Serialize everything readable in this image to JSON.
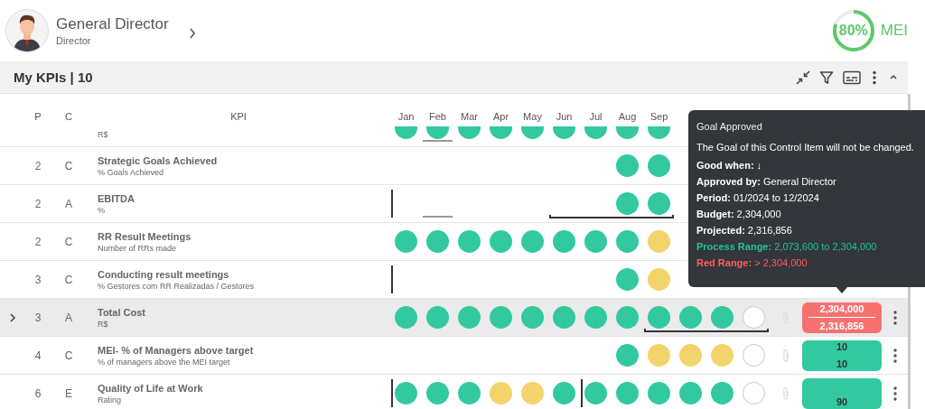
{
  "profile": {
    "name": "General Director",
    "role": "Director"
  },
  "score": {
    "value": "80%",
    "label": "MEI",
    "level": 0.8
  },
  "panel": {
    "title": "My KPIs | 10"
  },
  "columns": {
    "p": "P",
    "c": "C",
    "kpi": "KPI",
    "months": [
      "Jan",
      "Feb",
      "Mar",
      "Apr",
      "May",
      "Jun",
      "Jul",
      "Aug",
      "Sep"
    ]
  },
  "rows": [
    {
      "subtitle": "R$",
      "selected": false,
      "cells": [
        {
          "kind": "dot",
          "color": "#33c9a0"
        },
        {
          "kind": "dot",
          "color": "#33c9a0",
          "underline": true
        },
        {
          "kind": "dot",
          "color": "#33c9a0"
        },
        {
          "kind": "dot",
          "color": "#33c9a0"
        },
        {
          "kind": "dot",
          "color": "#33c9a0"
        },
        {
          "kind": "dot",
          "color": "#33c9a0"
        },
        {
          "kind": "dot",
          "color": "#33c9a0"
        },
        {
          "kind": "dot",
          "color": "#33c9a0"
        },
        {
          "kind": "dot",
          "color": "#33c9a0"
        }
      ]
    },
    {
      "p": "2",
      "c": "C",
      "title": "Strategic Goals Achieved",
      "subtitle": "% Goals Achieved",
      "selected": false,
      "cells": [
        {
          "kind": "none"
        },
        {
          "kind": "none"
        },
        {
          "kind": "none"
        },
        {
          "kind": "none"
        },
        {
          "kind": "none"
        },
        {
          "kind": "none"
        },
        {
          "kind": "none"
        },
        {
          "kind": "dot",
          "color": "#33c9a0"
        },
        {
          "kind": "dot",
          "color": "#33c9a0"
        }
      ]
    },
    {
      "p": "2",
      "c": "A",
      "title": "EBITDA",
      "subtitle": "%",
      "selected": false,
      "cells": [
        {
          "kind": "none",
          "period_start": true
        },
        {
          "kind": "none",
          "underline": true
        },
        {
          "kind": "none"
        },
        {
          "kind": "none"
        },
        {
          "kind": "none"
        },
        {
          "kind": "none",
          "in_range": true
        },
        {
          "kind": "none",
          "in_range": true
        },
        {
          "kind": "dot",
          "color": "#33c9a0",
          "in_range": true
        },
        {
          "kind": "dot",
          "color": "#33c9a0",
          "in_range": true
        }
      ]
    },
    {
      "p": "2",
      "c": "C",
      "title": "RR Result Meetings",
      "subtitle": "Number of RRs made",
      "selected": false,
      "cells": [
        {
          "kind": "dot",
          "color": "#33c9a0"
        },
        {
          "kind": "dot",
          "color": "#33c9a0"
        },
        {
          "kind": "dot",
          "color": "#33c9a0"
        },
        {
          "kind": "dot",
          "color": "#33c9a0"
        },
        {
          "kind": "dot",
          "color": "#33c9a0"
        },
        {
          "kind": "dot",
          "color": "#33c9a0"
        },
        {
          "kind": "dot",
          "color": "#33c9a0"
        },
        {
          "kind": "dot",
          "color": "#33c9a0"
        },
        {
          "kind": "dot",
          "color": "#f3d36c"
        }
      ]
    },
    {
      "p": "3",
      "c": "C",
      "title": "Conducting result meetings",
      "subtitle": "% Gestores com RR Realizadas / Gestores",
      "selected": false,
      "cells": [
        {
          "kind": "none",
          "period_start": true
        },
        {
          "kind": "none"
        },
        {
          "kind": "none"
        },
        {
          "kind": "none"
        },
        {
          "kind": "none"
        },
        {
          "kind": "none"
        },
        {
          "kind": "none"
        },
        {
          "kind": "dot",
          "color": "#33c9a0"
        },
        {
          "kind": "dot",
          "color": "#f3d36c"
        }
      ]
    },
    {
      "p": "3",
      "c": "A",
      "title": "Total Cost",
      "subtitle": "R$",
      "selected": true,
      "attachment": true,
      "menu": true,
      "result": {
        "color": "#f87171",
        "goal": "2,304,000",
        "actual": "2,316,856"
      },
      "cells": [
        {
          "kind": "dot",
          "color": "#33c9a0"
        },
        {
          "kind": "dot",
          "color": "#33c9a0"
        },
        {
          "kind": "dot",
          "color": "#33c9a0"
        },
        {
          "kind": "dot",
          "color": "#33c9a0"
        },
        {
          "kind": "dot",
          "color": "#33c9a0"
        },
        {
          "kind": "dot",
          "color": "#33c9a0"
        },
        {
          "kind": "dot",
          "color": "#33c9a0"
        },
        {
          "kind": "dot",
          "color": "#33c9a0"
        },
        {
          "kind": "dot",
          "color": "#33c9a0",
          "in_range": true
        },
        {
          "kind": "dot",
          "color": "#33c9a0",
          "in_range": true
        },
        {
          "kind": "dot",
          "color": "#33c9a0",
          "in_range": true
        },
        {
          "kind": "empty",
          "in_range": true
        }
      ]
    },
    {
      "p": "4",
      "c": "C",
      "title": "MEI- % of Managers above target",
      "subtitle": "% of managers above the MEI target",
      "selected": false,
      "attachment": true,
      "menu": true,
      "result": {
        "color": "#33c9a0",
        "goal": "10",
        "actual": "10"
      },
      "cells": [
        {
          "kind": "none"
        },
        {
          "kind": "none"
        },
        {
          "kind": "none"
        },
        {
          "kind": "none"
        },
        {
          "kind": "none"
        },
        {
          "kind": "none"
        },
        {
          "kind": "none"
        },
        {
          "kind": "dot",
          "color": "#33c9a0"
        },
        {
          "kind": "dot",
          "color": "#f3d36c"
        },
        {
          "kind": "dot",
          "color": "#f3d36c"
        },
        {
          "kind": "dot",
          "color": "#f3d36c"
        },
        {
          "kind": "empty"
        }
      ]
    },
    {
      "p": "6",
      "c": "E",
      "title": "Quality of Life at Work",
      "subtitle": "Rating",
      "selected": false,
      "attachment": true,
      "menu": true,
      "result": {
        "color": "#33c9a0",
        "actual": "90"
      },
      "cells": [
        {
          "kind": "dot",
          "color": "#33c9a0",
          "period_start": true
        },
        {
          "kind": "dot",
          "color": "#33c9a0"
        },
        {
          "kind": "dot",
          "color": "#33c9a0"
        },
        {
          "kind": "dot",
          "color": "#f3d36c"
        },
        {
          "kind": "dot",
          "color": "#f3d36c"
        },
        {
          "kind": "dot",
          "color": "#33c9a0"
        },
        {
          "kind": "dot",
          "color": "#33c9a0",
          "period_start": true
        },
        {
          "kind": "dot",
          "color": "#33c9a0"
        },
        {
          "kind": "dot",
          "color": "#33c9a0"
        },
        {
          "kind": "dot",
          "color": "#33c9a0"
        },
        {
          "kind": "dot",
          "color": "#33c9a0"
        },
        {
          "kind": "empty"
        }
      ]
    }
  ],
  "tooltip": {
    "title": "Goal Approved",
    "lines": [
      {
        "kind": "plain",
        "text": "The Goal of this Control Item will not be changed."
      },
      {
        "kind": "plain",
        "text": "**Good when: ↓**"
      },
      {
        "kind": "plain",
        "text": "**Approved by:** General Director"
      },
      {
        "kind": "plain",
        "text": "**Period:** 01/2024 to 12/2024"
      },
      {
        "kind": "plain",
        "text": "**Budget:** 2,304,000"
      },
      {
        "kind": "plain",
        "text": "**Projected:** 2,316,856"
      },
      {
        "kind": "good",
        "text": "**Process Range:** 2,073,600 to 2,304,000"
      },
      {
        "kind": "bad",
        "text": "**Red Range:** > 2,304,000"
      }
    ]
  }
}
